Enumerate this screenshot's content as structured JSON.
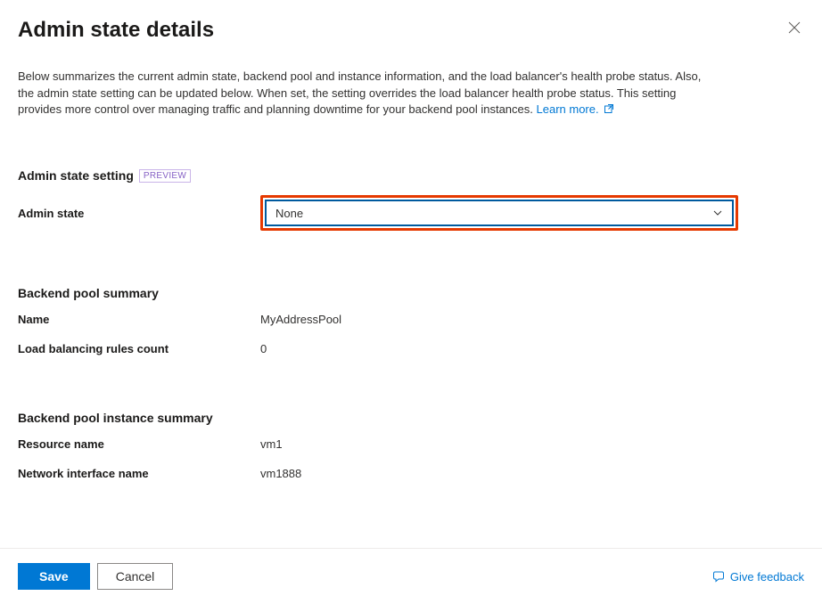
{
  "header": {
    "title": "Admin state details"
  },
  "description": {
    "text": "Below summarizes the current admin state, backend pool and instance information, and the load balancer's health probe status. Also, the admin state setting can be updated below. When set, the setting overrides the load balancer health probe status. This setting provides more control over managing traffic and planning downtime for your backend pool instances.",
    "learn_more_label": "Learn more."
  },
  "admin_state_section": {
    "heading": "Admin state setting",
    "badge": "PREVIEW",
    "label": "Admin state",
    "selected_value": "None"
  },
  "backend_pool_summary": {
    "heading": "Backend pool summary",
    "rows": [
      {
        "label": "Name",
        "value": "MyAddressPool"
      },
      {
        "label": "Load balancing rules count",
        "value": "0"
      }
    ]
  },
  "backend_pool_instance": {
    "heading": "Backend pool instance summary",
    "rows": [
      {
        "label": "Resource name",
        "value": "vm1"
      },
      {
        "label": "Network interface name",
        "value": "vm1888"
      }
    ]
  },
  "footer": {
    "save_label": "Save",
    "cancel_label": "Cancel",
    "feedback_label": "Give feedback"
  }
}
